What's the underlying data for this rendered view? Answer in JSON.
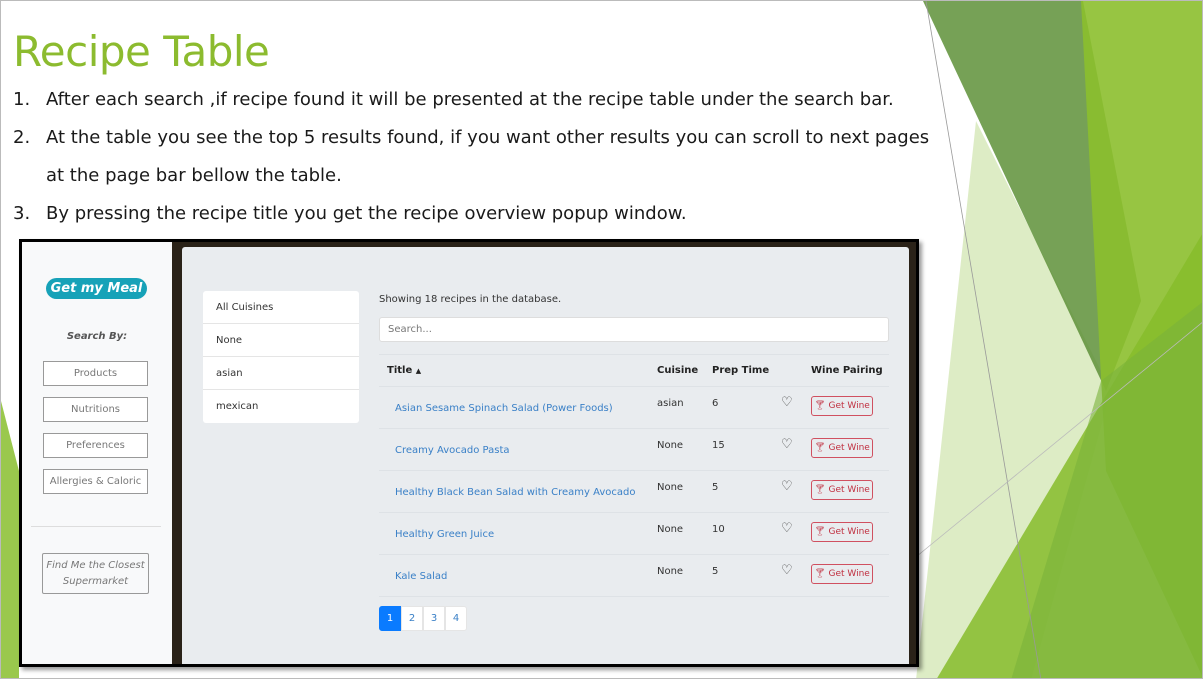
{
  "slide": {
    "title": "Recipe Table",
    "bullets": [
      {
        "num": "1.",
        "text": "After each search ,if recipe found it will be presented at the recipe table under the search bar."
      },
      {
        "num": "2.",
        "text": "At the table you see the top 5 results found, if you want other results you can scroll to next pages at the page bar bellow the table."
      },
      {
        "num": "3.",
        "text": "By pressing the recipe title you get the recipe overview popup window."
      }
    ]
  },
  "app": {
    "logo": "Get my Meal",
    "search_by": "Search By:",
    "side_buttons": [
      "Products",
      "Nutritions",
      "Preferences",
      "Allergies & Caloric"
    ],
    "find_button": "Find Me the Closest Supermarket",
    "cuisines": [
      "All Cuisines",
      "None",
      "asian",
      "mexican"
    ],
    "count_text": "Showing 18 recipes in the database.",
    "search_placeholder": "Search...",
    "headers": {
      "title": "Title",
      "sort_icon": "▲",
      "cuisine": "Cuisine",
      "prep": "Prep Time",
      "wine": "Wine Pairing"
    },
    "rows": [
      {
        "title": "Asian Sesame Spinach Salad (Power Foods)",
        "cuisine": "asian",
        "prep": "6"
      },
      {
        "title": "Creamy Avocado Pasta",
        "cuisine": "None",
        "prep": "15"
      },
      {
        "title": "Healthy Black Bean Salad with Creamy Avocado",
        "cuisine": "None",
        "prep": "5"
      },
      {
        "title": "Healthy Green Juice",
        "cuisine": "None",
        "prep": "10"
      },
      {
        "title": "Kale Salad",
        "cuisine": "None",
        "prep": "5"
      }
    ],
    "wine_label": "Get Wine",
    "pages": [
      "1",
      "2",
      "3",
      "4"
    ],
    "active_page": "1"
  },
  "colors": {
    "title": "#8cbb2f",
    "link": "#3a80c7",
    "primary": "#0a7bff",
    "danger": "#c03040",
    "logo": "#17a2b8"
  }
}
